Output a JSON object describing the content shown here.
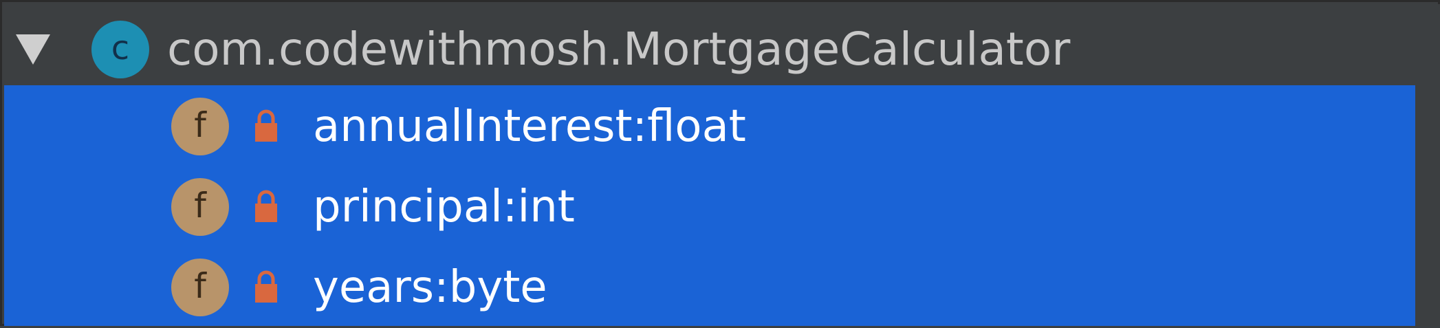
{
  "tree": {
    "class_node": {
      "label": "com.codewithmosh.MortgageCalculator",
      "icon": "class-icon",
      "icon_letter": "c",
      "expanded": true
    },
    "fields": [
      {
        "label": "annualInterest:float",
        "icon": "field-icon",
        "icon_letter": "f",
        "visibility": "lock-icon"
      },
      {
        "label": "principal:int",
        "icon": "field-icon",
        "icon_letter": "f",
        "visibility": "lock-icon"
      },
      {
        "label": "years:byte",
        "icon": "field-icon",
        "icon_letter": "f",
        "visibility": "lock-icon"
      }
    ]
  },
  "colors": {
    "background": "#3c3f41",
    "selection": "#1a63d6",
    "class_icon": "#1d8fb3",
    "field_icon": "#b8946a",
    "lock": "#d9683f"
  }
}
